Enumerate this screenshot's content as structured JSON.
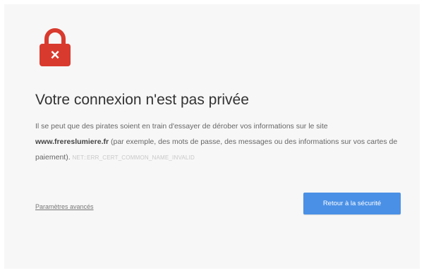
{
  "colors": {
    "background": "#f7f7f7",
    "lock_red": "#d93a2e",
    "button_blue": "#4a90e6",
    "title_text": "#333333"
  },
  "lock_icon": {
    "name": "lock-with-x-icon",
    "glyph": "×"
  },
  "heading": "Votre connexion n'est pas privée",
  "body": {
    "text_before": "Il se peut que des pirates soient en train d'essayer de dérober vos informations sur le site ",
    "domain": "www.frereslumiere.fr",
    "text_after": " (par exemple, des mots de passe, des messages ou des informations sur vos cartes de paiement).",
    "error_code": "NET::ERR_CERT_COMMON_NAME_INVALID"
  },
  "advanced_link": "Paramètres avancés",
  "back_button": "Retour à la sécurité"
}
